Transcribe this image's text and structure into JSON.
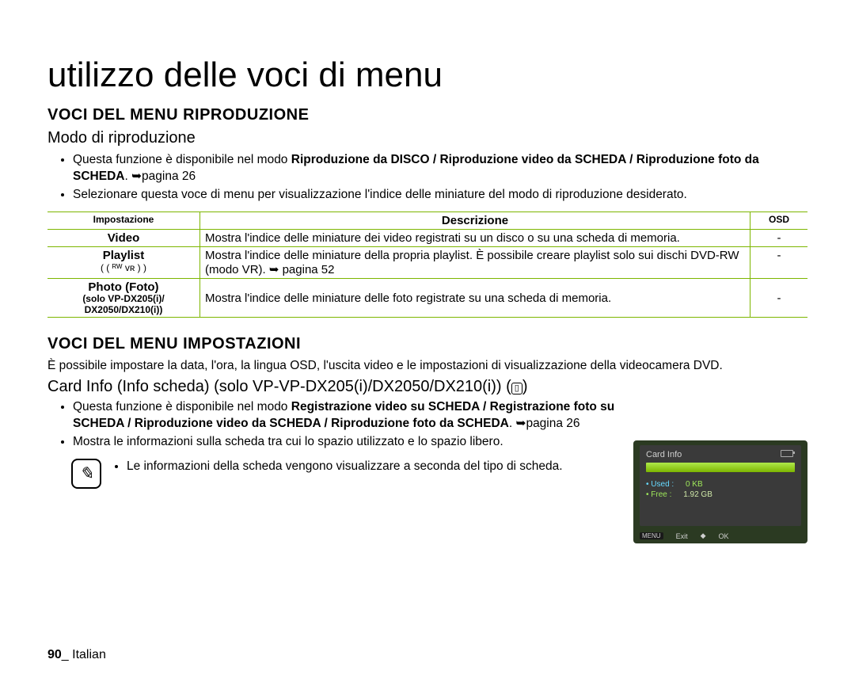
{
  "title": "utilizzo delle voci di menu",
  "section1": {
    "heading": "VOCI DEL MENU RIPRODUZIONE",
    "sub": "Modo di riproduzione",
    "bullet1_a": "Questa funzione è disponibile nel modo ",
    "bullet1_b": "Riproduzione da DISCO / Riproduzione video da SCHEDA / Riproduzione foto da SCHEDA",
    "bullet1_c": ". ➥pagina 26",
    "bullet2": "Selezionare questa voce di menu per visualizzazione l'indice delle miniature del modo di riproduzione desiderato."
  },
  "table": {
    "h1": "Impostazione",
    "h2": "Descrizione",
    "h3": "OSD",
    "r1c1": "Video",
    "r1c2": "Mostra l'indice delle miniature dei video registrati su un disco o su una scheda di memoria.",
    "r1c3": "-",
    "r2c1a": "Playlist",
    "r2c1b": "(  ( ᴿᵂ  ᴠʀ ) )",
    "r2c2": "Mostra l'indice delle miniature della propria playlist. È possibile creare playlist solo sui dischi DVD-RW (modo VR). ➥ pagina 52",
    "r2c3": "-",
    "r3c1a": "Photo (Foto)",
    "r3c1b": "(solo VP-DX205(i)/",
    "r3c1c": "DX2050/DX210(i))",
    "r3c2": "Mostra l'indice delle miniature delle foto registrate su una scheda di memoria.",
    "r3c3": "-"
  },
  "section2": {
    "heading": "VOCI DEL MENU IMPOSTAZIONI",
    "para": "È possibile impostare la data, l'ora, la lingua OSD, l'uscita video e le impostazioni di visualizzazione della videocamera DVD.",
    "sub2_a": "Card Info (Info scheda) (solo VP-VP-DX205(i)/DX2050/DX210(i)) (",
    "sub2_b": ")",
    "bullet1_a": "Questa funzione è disponibile nel modo ",
    "bullet1_b": "Registrazione video su SCHEDA / Registrazione foto su SCHEDA / Riproduzione video da SCHEDA / Riproduzione foto da SCHEDA",
    "bullet1_c": ". ➥pagina 26",
    "bullet2": "Mostra le informazioni sulla scheda tra cui lo spazio utilizzato e lo spazio libero.",
    "note": "Le informazioni della scheda vengono visualizzare a seconda del tipo di scheda."
  },
  "osd": {
    "title": "Card Info",
    "used_label": "• Used",
    "used_val": "0 KB",
    "free_label": "• Free",
    "free_val": "1.92 GB",
    "menu": "MENU",
    "exit": "Exit",
    "ok": "OK"
  },
  "footer": {
    "page": "90",
    "sep": "_ ",
    "lang": "Italian"
  }
}
